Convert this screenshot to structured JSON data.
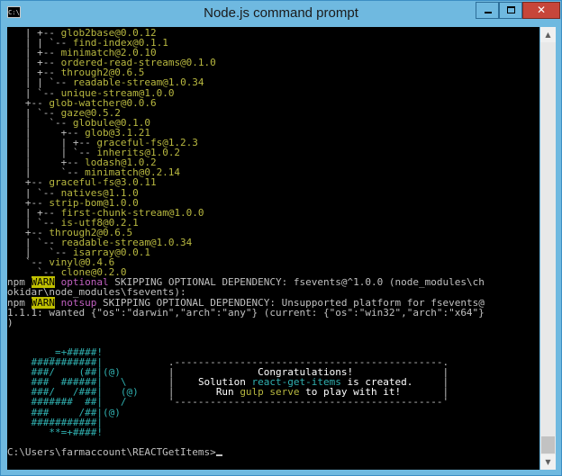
{
  "window": {
    "title": "Node.js command prompt",
    "app_icon_text": "C:\\",
    "close_glyph": "✕"
  },
  "scrollbar": {
    "up_icon": "▲",
    "down_icon": "▼"
  },
  "console": {
    "tree_lines": [
      {
        "prefix": "   | +-- ",
        "text": "glob2base@0.0.12"
      },
      {
        "prefix": "   | | `-- ",
        "text": "find-index@0.1.1"
      },
      {
        "prefix": "   | +-- ",
        "text": "minimatch@2.0.10"
      },
      {
        "prefix": "   | +-- ",
        "text": "ordered-read-streams@0.1.0"
      },
      {
        "prefix": "   | +-- ",
        "text": "through2@0.6.5"
      },
      {
        "prefix": "   | | `-- ",
        "text": "readable-stream@1.0.34"
      },
      {
        "prefix": "   | `-- ",
        "text": "unique-stream@1.0.0"
      },
      {
        "prefix": "   +-- ",
        "text": "glob-watcher@0.0.6"
      },
      {
        "prefix": "   | `-- ",
        "text": "gaze@0.5.2"
      },
      {
        "prefix": "   |   `-- ",
        "text": "globule@0.1.0"
      },
      {
        "prefix": "   |     +-- ",
        "text": "glob@3.1.21"
      },
      {
        "prefix": "   |     | +-- ",
        "text": "graceful-fs@1.2.3"
      },
      {
        "prefix": "   |     | `-- ",
        "text": "inherits@1.0.2"
      },
      {
        "prefix": "   |     +-- ",
        "text": "lodash@1.0.2"
      },
      {
        "prefix": "   |     `-- ",
        "text": "minimatch@0.2.14"
      },
      {
        "prefix": "   +-- ",
        "text": "graceful-fs@3.0.11"
      },
      {
        "prefix": "   | `-- ",
        "text": "natives@1.1.0"
      },
      {
        "prefix": "   +-- ",
        "text": "strip-bom@1.0.0"
      },
      {
        "prefix": "   | +-- ",
        "text": "first-chunk-stream@1.0.0"
      },
      {
        "prefix": "   | `-- ",
        "text": "is-utf8@0.2.1"
      },
      {
        "prefix": "   +-- ",
        "text": "through2@0.6.5"
      },
      {
        "prefix": "   | `-- ",
        "text": "readable-stream@1.0.34"
      },
      {
        "prefix": "   |   `-- ",
        "text": "isarray@0.0.1"
      },
      {
        "prefix": "   `-- ",
        "text": "vinyl@0.4.6"
      },
      {
        "prefix": "     `-- ",
        "text": "clone@0.2.0"
      }
    ],
    "npm_label": "npm",
    "warn_badge": "WARN",
    "optional_label": "optional",
    "warn1_text": " SKIPPING OPTIONAL DEPENDENCY: fsevents@^1.0.0 (node_modules\\ch",
    "warn1_cont": "okidar\\node_modules\\fsevents):",
    "notsup_label": "notsup",
    "warn2_text": " SKIPPING OPTIONAL DEPENDENCY: Unsupported platform for fsevents@",
    "warn2_cont": "1.1.1: wanted {\"os\":\"darwin\",\"arch\":\"any\"} (current: {\"os\":\"win32\",\"arch\":\"x64\"}",
    "warn2_end": ")",
    "art_lines": [
      "       _=+#####!",
      "    ###########|",
      "    ###/    (##|(@)",
      "    ###  ######|   \\",
      "    ###/   /###|   (@)",
      "    #######  ##|   /",
      "    ###     /##|(@)",
      "    ###########|",
      "       **=+####!"
    ],
    "banner_top": "   .---------------------------------------------.",
    "banner_empty": "   |                                             |",
    "banner_bottom": "   '---------------------------------------------'",
    "congrats": "Congratulations!",
    "solution_pre": "Solution ",
    "solution_name": "react-get-items",
    "solution_post": " is created.",
    "run_pre": "Run ",
    "run_cmd": "gulp serve",
    "run_post": " to play with it!",
    "prompt": "C:\\Users\\farmaccount\\REACTGetItems>"
  }
}
